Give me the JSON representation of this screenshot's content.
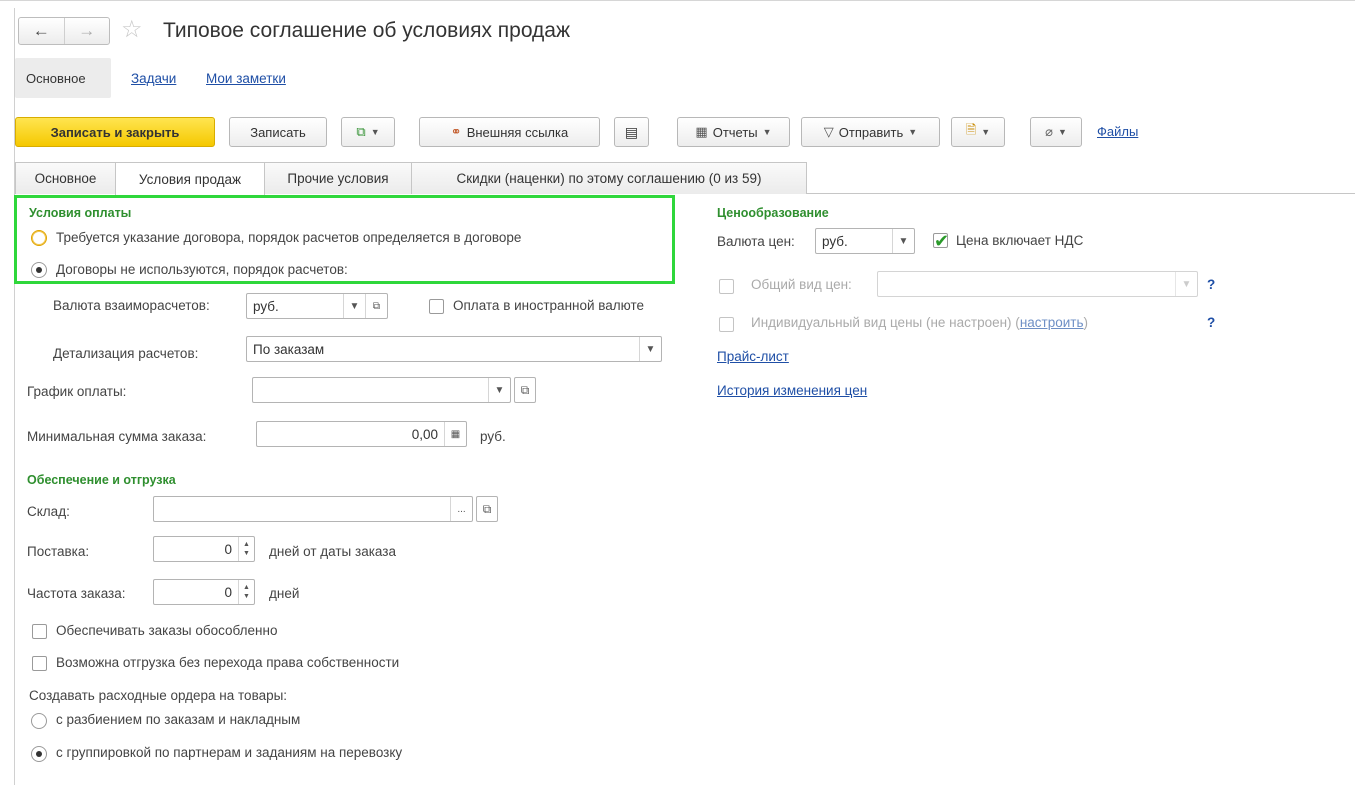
{
  "title": "Типовое соглашение об условиях продаж",
  "nav": {
    "back": "←",
    "forward": "→"
  },
  "sections": [
    "Основное",
    "Задачи",
    "Мои заметки"
  ],
  "toolbar": {
    "save_close": "Записать и закрыть",
    "save": "Записать",
    "external_link": "Внешняя ссылка",
    "reports": "Отчеты",
    "send": "Отправить",
    "files": "Файлы"
  },
  "tabs": [
    "Основное",
    "Условия продаж",
    "Прочие условия",
    "Скидки (наценки) по этому соглашению (0 из 59)"
  ],
  "active_tab": "Условия продаж",
  "payment": {
    "title": "Условия оплаты",
    "option1": "Требуется указание договора, порядок расчетов определяется в договоре",
    "option2": "Договоры не используются, порядок расчетов:",
    "selected": 2,
    "currency_label": "Валюта взаиморасчетов:",
    "currency_value": "руб.",
    "foreign_currency_label": "Оплата в иностранной валюте",
    "foreign_currency_checked": false,
    "detail_label": "Детализация расчетов:",
    "detail_value": "По заказам",
    "schedule_label": "График оплаты:",
    "schedule_value": "",
    "min_sum_label": "Минимальная сумма заказа:",
    "min_sum_value": "0,00",
    "min_sum_unit": "руб."
  },
  "pricing": {
    "title": "Ценообразование",
    "currency_label": "Валюта цен:",
    "currency_value": "руб.",
    "vat_label": "Цена включает НДС",
    "vat_checked": true,
    "common_price_label": "Общий вид цен:",
    "common_price_value": "",
    "individual_label": "Индивидуальный вид цены (не настроен) (",
    "individual_link": "настроить",
    "individual_tail": ")",
    "help": "?",
    "price_list": "Прайс-лист",
    "history": "История изменения цен"
  },
  "shipping": {
    "title": "Обеспечение и отгрузка",
    "warehouse_label": "Склад:",
    "warehouse_value": "",
    "warehouse_select": "...",
    "delivery_label": "Поставка:",
    "delivery_value": "0",
    "delivery_unit": "дней от даты заказа",
    "frequency_label": "Частота заказа:",
    "frequency_value": "0",
    "frequency_unit": "дней",
    "separate_label": "Обеспечивать заказы обособленно",
    "separate_checked": false,
    "no_ownership_label": "Возможна отгрузка без перехода права собственности",
    "no_ownership_checked": false,
    "orders_label": "Создавать расходные ордера на товары:",
    "orders_option1": "с разбиением по заказам и накладным",
    "orders_option2": "с группировкой по партнерам и заданиям на перевозку",
    "orders_selected": 2
  },
  "colors": {
    "accent": "#f5c800",
    "group_title": "#2f8f2f",
    "link": "#1f4fa6",
    "highlight": "#2fd73b"
  }
}
